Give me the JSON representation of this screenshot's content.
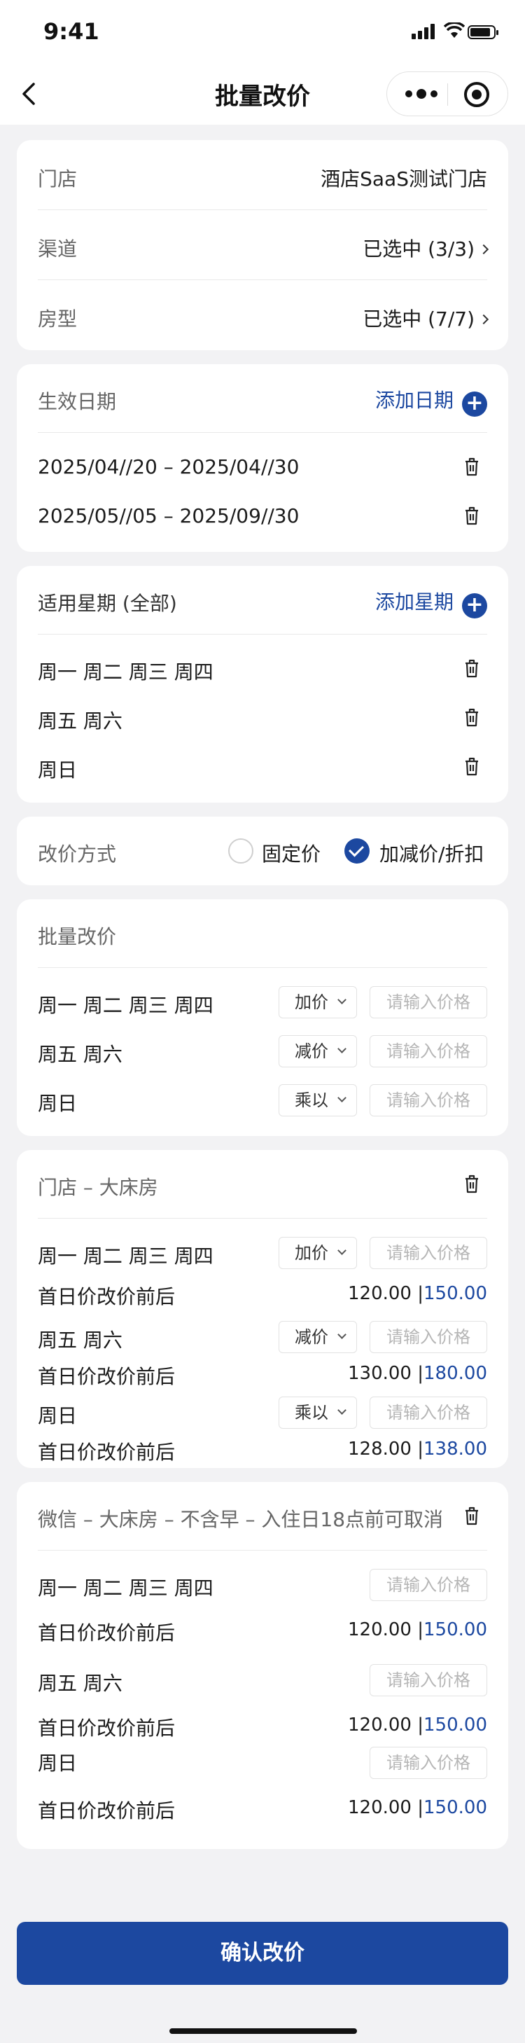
{
  "status_bar": {
    "time": "9:41"
  },
  "nav": {
    "title": "批量改价"
  },
  "store_card": {
    "store_label": "门店",
    "store_value": "酒店SaaS测试门店",
    "channel_label": "渠道",
    "channel_value": "已选中 (3/3)",
    "room_label": "房型",
    "room_value": "已选中 (7/7)"
  },
  "date_card": {
    "title": "生效日期",
    "add_label": "添加日期",
    "ranges": [
      "2025/04//20 – 2025/04//30",
      "2025/05//05 – 2025/09//30"
    ]
  },
  "weekday_card": {
    "title": "适用星期 (全部)",
    "add_label": "添加星期",
    "groups": [
      "周一 周二 周三 周四",
      "周五 周六",
      "周日"
    ]
  },
  "method_card": {
    "label": "改价方式",
    "option_fixed": "固定价",
    "option_adjust": "加减价/折扣"
  },
  "batch_card": {
    "title": "批量改价",
    "placeholder": "请输入价格",
    "rows": [
      {
        "days": "周一 周二 周三 周四",
        "op": "加价"
      },
      {
        "days": "周五 周六",
        "op": "减价"
      },
      {
        "days": "周日",
        "op": "乘以"
      }
    ]
  },
  "store_room_card": {
    "title": "门店 – 大床房",
    "placeholder": "请输入价格",
    "rows": [
      {
        "days": "周一 周二 周三 周四",
        "op": "加价",
        "preview_label": "首日价改价前后",
        "before": "120.00",
        "after": "150.00"
      },
      {
        "days": "周五 周六",
        "op": "减价",
        "preview_label": "首日价改价前后",
        "before": "130.00",
        "after": "180.00"
      },
      {
        "days": "周日",
        "op": "乘以",
        "preview_label": "首日价改价前后",
        "before": "128.00",
        "after": "138.00"
      }
    ]
  },
  "wechat_card": {
    "title": "微信 – 大床房 – 不含早 – 入住日18点前可取消",
    "placeholder": "请输入价格",
    "rows": [
      {
        "days": "周一 周二 周三 周四",
        "preview_label": "首日价改价前后",
        "before": "120.00",
        "after": "150.00"
      },
      {
        "days": "周五 周六",
        "preview_label": "首日价改价前后",
        "before": "120.00",
        "after": "150.00"
      },
      {
        "days": "周日",
        "preview_label": "首日价改价前后",
        "before": "120.00",
        "after": "150.00"
      }
    ]
  },
  "footer": {
    "confirm_label": "确认改价"
  },
  "colors": {
    "accent": "#1c48a0",
    "background": "#f2f2f4"
  }
}
